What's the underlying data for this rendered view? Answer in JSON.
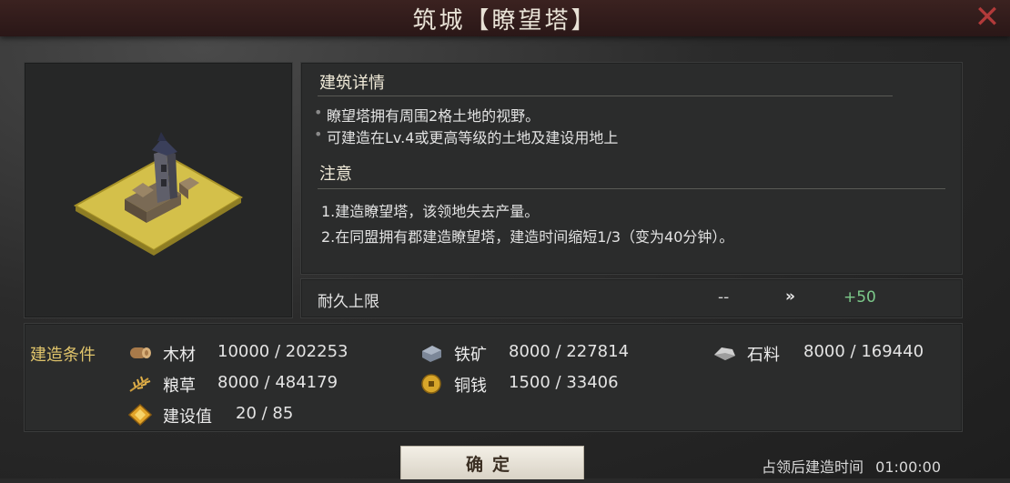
{
  "window": {
    "title": "筑城【瞭望塔】",
    "close_icon": "close-icon"
  },
  "details": {
    "section_title": "建筑详情",
    "bullets": [
      "瞭望塔拥有周围2格土地的视野。",
      "可建造在Lv.4或更高等级的土地及建设用地上"
    ],
    "note_title": "注意",
    "notes": [
      "1.建造瞭望塔，该领地失去产量。",
      "2.在同盟拥有郡建造瞭望塔，建造时间缩短1/3（变为40分钟）。"
    ]
  },
  "durability": {
    "label": "耐久上限",
    "old_value": "--",
    "arrow": "»",
    "new_value": "+50"
  },
  "requirements": {
    "title": "建造条件",
    "items": [
      {
        "icon": "wood-log-icon",
        "name": "木材",
        "value": "10000 / 202253"
      },
      {
        "icon": "iron-ore-icon",
        "name": "铁矿",
        "value": "8000 / 227814"
      },
      {
        "icon": "stone-icon",
        "name": "石料",
        "value": "8000 / 169440"
      },
      {
        "icon": "grain-icon",
        "name": "粮草",
        "value": "8000 / 484179"
      },
      {
        "icon": "copper-coin-icon",
        "name": "铜钱",
        "value": "1500 / 33406"
      },
      {
        "icon": "construction-point-icon",
        "name": "建设值",
        "value": "20 / 85"
      }
    ]
  },
  "footer": {
    "confirm_label": "确定",
    "build_time_label": "占领后建造时间",
    "build_time_value": "01:00:00"
  },
  "colors": {
    "accent_gold": "#e0c46b",
    "positive_green": "#7cc98a",
    "close_red": "#b23a3a"
  }
}
